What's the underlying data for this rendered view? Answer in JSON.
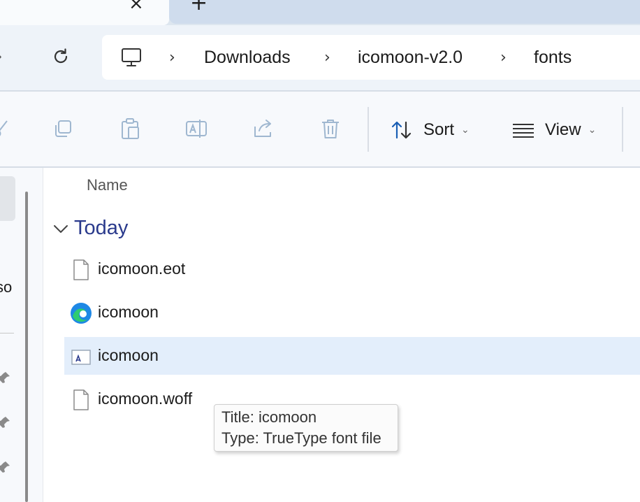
{
  "tabs": {
    "close_glyph": "×",
    "new_tab_glyph": "+"
  },
  "address": {
    "breadcrumb": [
      "Downloads",
      "icomoon-v2.0",
      "fonts"
    ],
    "separator": "›"
  },
  "toolbar": {
    "sort_label": "Sort",
    "view_label": "View",
    "caret": "⌄",
    "icons": [
      "cut-icon",
      "copy-icon",
      "paste-icon",
      "rename-icon",
      "share-icon",
      "delete-icon"
    ]
  },
  "leftnav": {
    "partial_text": "so"
  },
  "content": {
    "column_name": "Name",
    "group_label": "Today",
    "files": [
      {
        "name": "icomoon.eot",
        "icon": "blank-file-icon"
      },
      {
        "name": "icomoon",
        "icon": "edge-browser-icon"
      },
      {
        "name": "icomoon",
        "icon": "font-file-icon",
        "selected": true
      },
      {
        "name": "icomoon.woff",
        "icon": "blank-file-icon"
      }
    ]
  },
  "tooltip": {
    "title_line": "Title: icomoon",
    "type_line": "Type: TrueType font file"
  },
  "colors": {
    "accent_group": "#2a3a8c",
    "selection": "#e3eefb",
    "edge_blue": "#1e88e5",
    "edge_green": "#2ecc71"
  }
}
